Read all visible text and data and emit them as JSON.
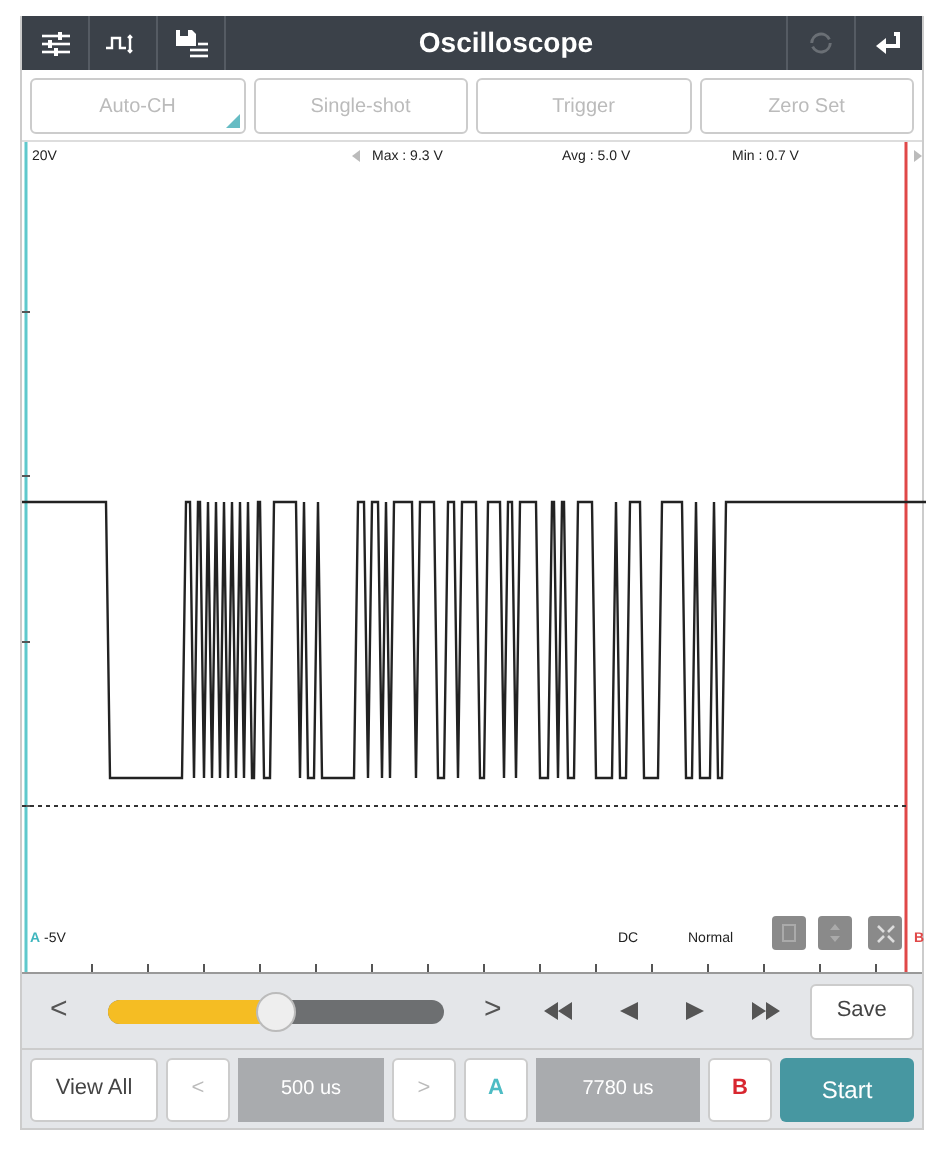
{
  "title_bar": {
    "title": "Oscilloscope"
  },
  "mode_buttons": [
    {
      "label": "Auto-CH",
      "disabled": true,
      "dropdown": true
    },
    {
      "label": "Single-shot",
      "disabled": true,
      "dropdown": false
    },
    {
      "label": "Trigger",
      "disabled": true,
      "dropdown": false
    },
    {
      "label": "Zero Set",
      "disabled": true,
      "dropdown": false
    }
  ],
  "plot": {
    "scale_top": "20V",
    "max": "Max : 9.3 V",
    "avg": "Avg : 5.0 V",
    "min": "Min : 0.7 V",
    "scale_bottom": "-5V",
    "coupling": "DC",
    "trigger_mode": "Normal",
    "cursor_a": "A",
    "cursor_b": "B"
  },
  "scroll": {
    "prev": "<",
    "next": ">",
    "save": "Save"
  },
  "bottom": {
    "view_all": "View All",
    "time_prev": "<",
    "time_div": "500 us",
    "time_next": ">",
    "a": "A",
    "cursor_time": "7780 us",
    "b": "B",
    "start": "Start"
  }
}
